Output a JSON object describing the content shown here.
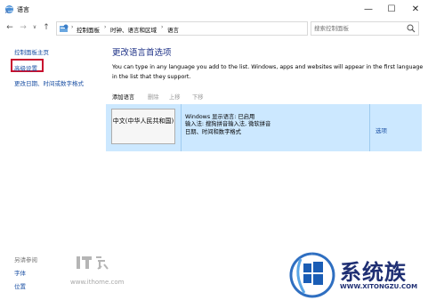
{
  "window": {
    "title": "语言",
    "minimize_glyph": "—",
    "maximize_glyph": "☐",
    "close_glyph": "✕"
  },
  "nav": {
    "back_glyph": "←",
    "forward_glyph": "→",
    "history_glyph": "∨",
    "up_glyph": "↑"
  },
  "address": {
    "crumbs": [
      "控制面板",
      "时钟、语言和区域",
      "语言"
    ],
    "separator": "›",
    "dropdown_glyph": "∨",
    "refresh_glyph": "↻"
  },
  "search": {
    "placeholder": "搜索控制面板"
  },
  "sidebar": {
    "home": "控制面板主页",
    "advanced": "高级设置",
    "date_format": "更改日期、时间或数字格式",
    "see_also": "另请参阅",
    "font": "字体",
    "location": "位置"
  },
  "main": {
    "title": "更改语言首选项",
    "description": "You can type in any language you add to the list. Windows, apps and websites will appear in the first language in the list that they support."
  },
  "toolbar": {
    "add": "添加语言",
    "remove": "删除",
    "move_up": "上移",
    "move_down": "下移"
  },
  "languages": [
    {
      "name": "中文(中华人民共和国)",
      "lines": [
        "Windows 显示语言: 已启用",
        "输入法: 搜狗拼音输入法, 微软拼音",
        "日期、时间和数字格式"
      ],
      "options": "选项"
    }
  ],
  "watermarks": {
    "ithome_url": "www.ithome.com",
    "brand_name": "系统族",
    "brand_url": "WWW.XITONGZU.COM"
  },
  "colors": {
    "accent_link": "#1a4fa3",
    "title_blue": "#1e3287",
    "selected_row": "#cce8ff",
    "highlight_box": "#c8102e",
    "brand": "#1f2f73"
  },
  "icons": {
    "window": "control-panel-language-icon",
    "address": "control-panel-icon",
    "search": "search-icon"
  }
}
